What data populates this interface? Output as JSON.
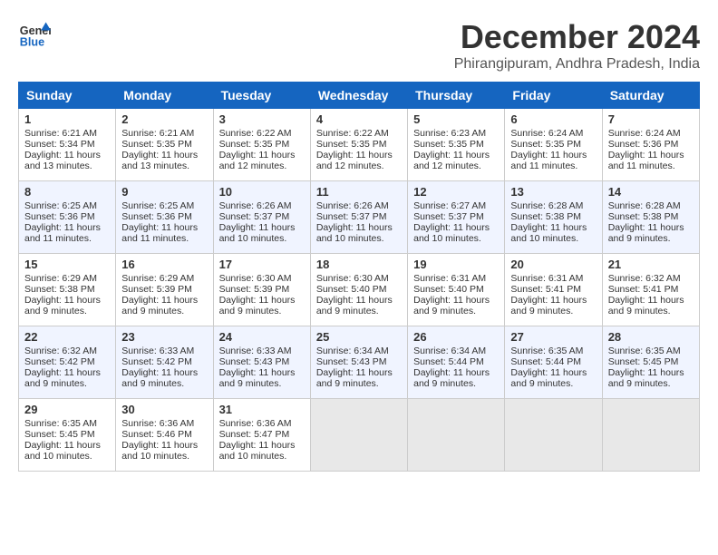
{
  "header": {
    "logo_line1": "General",
    "logo_line2": "Blue",
    "month": "December 2024",
    "location": "Phirangipuram, Andhra Pradesh, India"
  },
  "days_of_week": [
    "Sunday",
    "Monday",
    "Tuesday",
    "Wednesday",
    "Thursday",
    "Friday",
    "Saturday"
  ],
  "weeks": [
    [
      {
        "day": 1,
        "rise": "6:21 AM",
        "set": "5:34 PM",
        "daylight": "11 hours and 13 minutes."
      },
      {
        "day": 2,
        "rise": "6:21 AM",
        "set": "5:35 PM",
        "daylight": "11 hours and 13 minutes."
      },
      {
        "day": 3,
        "rise": "6:22 AM",
        "set": "5:35 PM",
        "daylight": "11 hours and 12 minutes."
      },
      {
        "day": 4,
        "rise": "6:22 AM",
        "set": "5:35 PM",
        "daylight": "11 hours and 12 minutes."
      },
      {
        "day": 5,
        "rise": "6:23 AM",
        "set": "5:35 PM",
        "daylight": "11 hours and 12 minutes."
      },
      {
        "day": 6,
        "rise": "6:24 AM",
        "set": "5:35 PM",
        "daylight": "11 hours and 11 minutes."
      },
      {
        "day": 7,
        "rise": "6:24 AM",
        "set": "5:36 PM",
        "daylight": "11 hours and 11 minutes."
      }
    ],
    [
      {
        "day": 8,
        "rise": "6:25 AM",
        "set": "5:36 PM",
        "daylight": "11 hours and 11 minutes."
      },
      {
        "day": 9,
        "rise": "6:25 AM",
        "set": "5:36 PM",
        "daylight": "11 hours and 11 minutes."
      },
      {
        "day": 10,
        "rise": "6:26 AM",
        "set": "5:37 PM",
        "daylight": "11 hours and 10 minutes."
      },
      {
        "day": 11,
        "rise": "6:26 AM",
        "set": "5:37 PM",
        "daylight": "11 hours and 10 minutes."
      },
      {
        "day": 12,
        "rise": "6:27 AM",
        "set": "5:37 PM",
        "daylight": "11 hours and 10 minutes."
      },
      {
        "day": 13,
        "rise": "6:28 AM",
        "set": "5:38 PM",
        "daylight": "11 hours and 10 minutes."
      },
      {
        "day": 14,
        "rise": "6:28 AM",
        "set": "5:38 PM",
        "daylight": "11 hours and 9 minutes."
      }
    ],
    [
      {
        "day": 15,
        "rise": "6:29 AM",
        "set": "5:38 PM",
        "daylight": "11 hours and 9 minutes."
      },
      {
        "day": 16,
        "rise": "6:29 AM",
        "set": "5:39 PM",
        "daylight": "11 hours and 9 minutes."
      },
      {
        "day": 17,
        "rise": "6:30 AM",
        "set": "5:39 PM",
        "daylight": "11 hours and 9 minutes."
      },
      {
        "day": 18,
        "rise": "6:30 AM",
        "set": "5:40 PM",
        "daylight": "11 hours and 9 minutes."
      },
      {
        "day": 19,
        "rise": "6:31 AM",
        "set": "5:40 PM",
        "daylight": "11 hours and 9 minutes."
      },
      {
        "day": 20,
        "rise": "6:31 AM",
        "set": "5:41 PM",
        "daylight": "11 hours and 9 minutes."
      },
      {
        "day": 21,
        "rise": "6:32 AM",
        "set": "5:41 PM",
        "daylight": "11 hours and 9 minutes."
      }
    ],
    [
      {
        "day": 22,
        "rise": "6:32 AM",
        "set": "5:42 PM",
        "daylight": "11 hours and 9 minutes."
      },
      {
        "day": 23,
        "rise": "6:33 AM",
        "set": "5:42 PM",
        "daylight": "11 hours and 9 minutes."
      },
      {
        "day": 24,
        "rise": "6:33 AM",
        "set": "5:43 PM",
        "daylight": "11 hours and 9 minutes."
      },
      {
        "day": 25,
        "rise": "6:34 AM",
        "set": "5:43 PM",
        "daylight": "11 hours and 9 minutes."
      },
      {
        "day": 26,
        "rise": "6:34 AM",
        "set": "5:44 PM",
        "daylight": "11 hours and 9 minutes."
      },
      {
        "day": 27,
        "rise": "6:35 AM",
        "set": "5:44 PM",
        "daylight": "11 hours and 9 minutes."
      },
      {
        "day": 28,
        "rise": "6:35 AM",
        "set": "5:45 PM",
        "daylight": "11 hours and 9 minutes."
      }
    ],
    [
      {
        "day": 29,
        "rise": "6:35 AM",
        "set": "5:45 PM",
        "daylight": "11 hours and 10 minutes."
      },
      {
        "day": 30,
        "rise": "6:36 AM",
        "set": "5:46 PM",
        "daylight": "11 hours and 10 minutes."
      },
      {
        "day": 31,
        "rise": "6:36 AM",
        "set": "5:47 PM",
        "daylight": "11 hours and 10 minutes."
      },
      null,
      null,
      null,
      null
    ]
  ]
}
